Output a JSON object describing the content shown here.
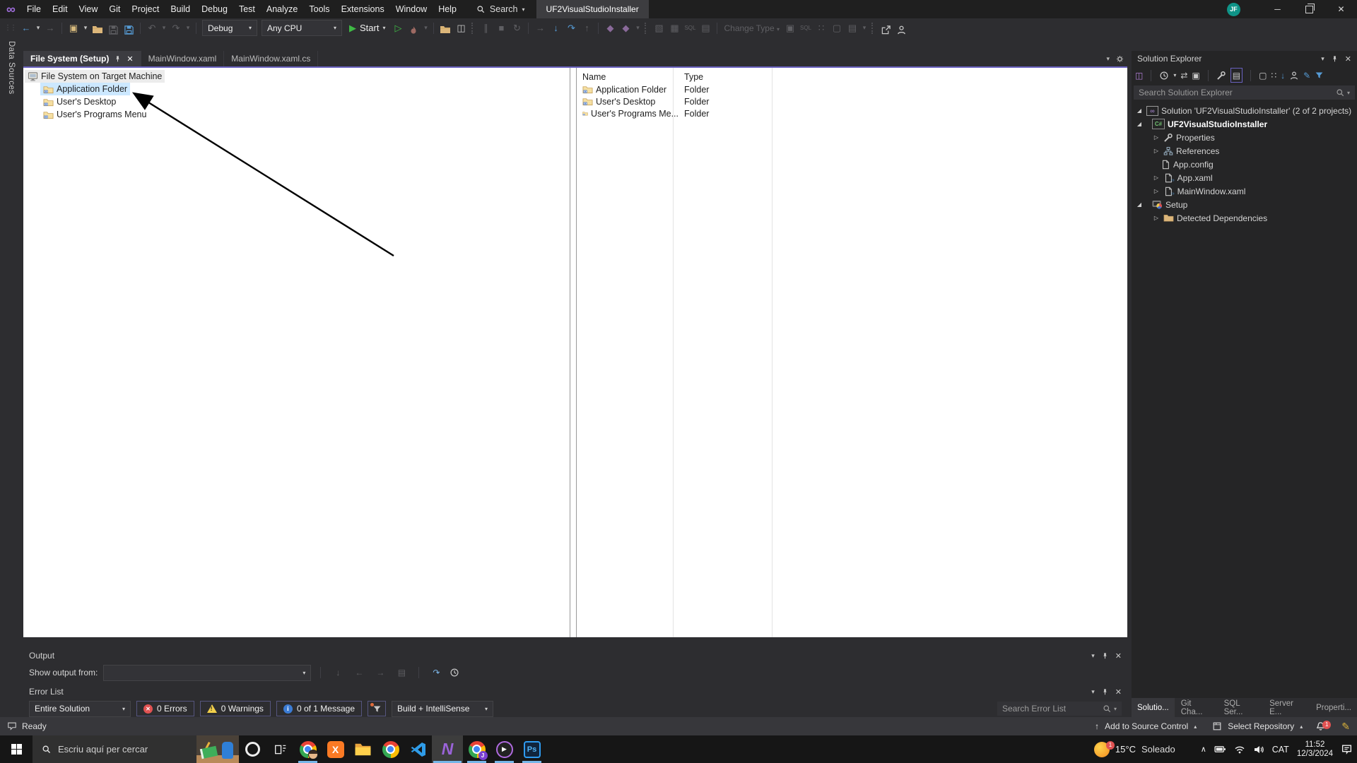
{
  "window": {
    "title": "UF2VisualStudioInstaller",
    "avatar_initials": "JF"
  },
  "menu": {
    "items": [
      "File",
      "Edit",
      "View",
      "Git",
      "Project",
      "Build",
      "Debug",
      "Test",
      "Analyze",
      "Tools",
      "Extensions",
      "Window",
      "Help"
    ],
    "search_label": "Search"
  },
  "toolbar": {
    "configuration_value": "Debug",
    "platform_value": "Any CPU",
    "start_label": "Start",
    "change_type_label": "Change Type",
    "sql_label": "SQL"
  },
  "left_strip": {
    "label": "Data Sources"
  },
  "editor": {
    "tabs": [
      {
        "label": "File System (Setup)"
      },
      {
        "label": "MainWindow.xaml"
      },
      {
        "label": "MainWindow.xaml.cs"
      }
    ],
    "file_system_tree": {
      "root": "File System on Target Machine",
      "items": [
        "Application Folder",
        "User's Desktop",
        "User's Programs Menu"
      ]
    },
    "list": {
      "columns": [
        "Name",
        "Type"
      ],
      "rows": [
        {
          "name": "Application Folder",
          "type": "Folder"
        },
        {
          "name": "User's Desktop",
          "type": "Folder"
        },
        {
          "name": "User's Programs Me...",
          "type": "Folder"
        }
      ]
    }
  },
  "solution_explorer": {
    "title": "Solution Explorer",
    "search_placeholder": "Search Solution Explorer",
    "tree": [
      {
        "label": "Solution 'UF2VisualStudioInstaller' (2 of 2 projects)"
      },
      {
        "label": "UF2VisualStudioInstaller"
      },
      {
        "label": "Properties"
      },
      {
        "label": "References"
      },
      {
        "label": "App.config"
      },
      {
        "label": "App.xaml"
      },
      {
        "label": "MainWindow.xaml"
      },
      {
        "label": "Setup"
      },
      {
        "label": "Detected Dependencies"
      }
    ],
    "bottom_tabs": [
      "Solutio...",
      "Git Cha...",
      "SQL Ser...",
      "Server E...",
      "Properti..."
    ]
  },
  "output_panel": {
    "title": "Output",
    "show_output_from_label": "Show output from:",
    "source_value": ""
  },
  "error_list": {
    "title": "Error List",
    "scope_value": "Entire Solution",
    "errors_label": "0 Errors",
    "warnings_label": "0 Warnings",
    "messages_label": "0 of 1 Message",
    "filter_value": "Build + IntelliSense",
    "search_placeholder": "Search Error List"
  },
  "status_bar": {
    "ready_label": "Ready",
    "add_to_source_control_label": "Add to Source Control",
    "select_repository_label": "Select Repository",
    "notification_count": "1"
  },
  "taskbar": {
    "search_placeholder": "Escriu aquí per cercar",
    "app_glyphs": {
      "xampp": "X",
      "photoshop": "Ps",
      "chrome_profile_badge": "J",
      "visual_studio": "N",
      "media_player": "▶"
    },
    "weather": {
      "temperature": "15°C",
      "condition": "Soleado",
      "badge": "1"
    },
    "tray": {
      "language": "CAT",
      "time": "11:52",
      "date": "12/3/2024"
    }
  },
  "icons": {
    "caret_down": "▾",
    "caret_up": "▴",
    "back": "←",
    "forward": "→",
    "undo": "↶",
    "redo": "↷",
    "pause": "∥",
    "stop": "■",
    "restart": "↻",
    "next_statement": "→",
    "step_into": "↓",
    "step_over": "↷",
    "step_out": "↑",
    "start_play": "▶",
    "start_alt_play": "▷",
    "refresh": "⇄",
    "close": "✕",
    "minimize": "─",
    "vs_infinity": "∞",
    "expanded_arrow": "◢",
    "collapsed_arrow": "▷",
    "overflow_chevron": "∧",
    "arrow_up": "↑",
    "exclamation": "!",
    "info_i": "i",
    "diamond": "◆",
    "grid": "▦",
    "orgchart": "▧",
    "table": "▤",
    "window_box": "▣",
    "collapse_all": "▣",
    "switch_view": "◫",
    "preview_dots": "∷",
    "show_all": "▢",
    "edit_pencil": "✎",
    "grip_dots": "⋮⋮"
  }
}
